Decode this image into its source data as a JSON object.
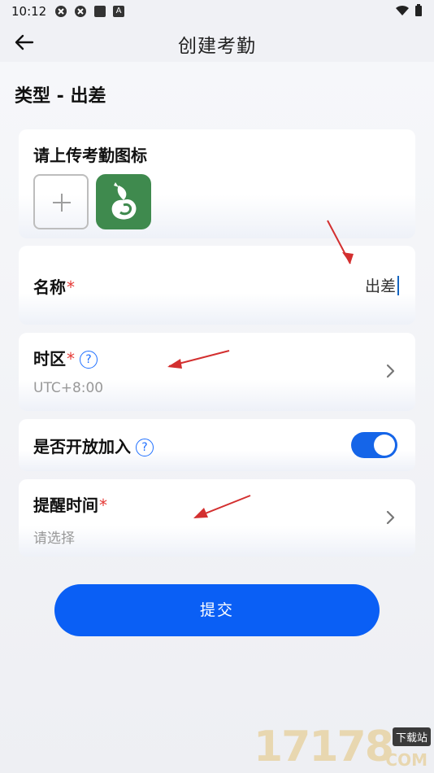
{
  "status_bar": {
    "time": "10:12",
    "badge": "A"
  },
  "app_bar": {
    "title": "创建考勤"
  },
  "type_label": "类型 - 出差",
  "upload": {
    "label": "请上传考勤图标"
  },
  "name_field": {
    "label": "名称",
    "required_mark": "*",
    "value": "出差"
  },
  "timezone_field": {
    "label": "时区",
    "required_mark": "*",
    "help": "?",
    "value": "UTC+8:00"
  },
  "open_join": {
    "label": "是否开放加入",
    "help": "?",
    "enabled": true
  },
  "reminder_field": {
    "label": "提醒时间",
    "required_mark": "*",
    "placeholder": "请选择"
  },
  "submit": {
    "label": "提交"
  },
  "watermark": {
    "number": "17178",
    "badge": "下载站",
    "domain": "COM"
  },
  "colors": {
    "accent": "#0a5ff5",
    "required": "#e53935",
    "annotation_arrow": "#d32f2f",
    "app_icon": "#3f8a4e"
  }
}
